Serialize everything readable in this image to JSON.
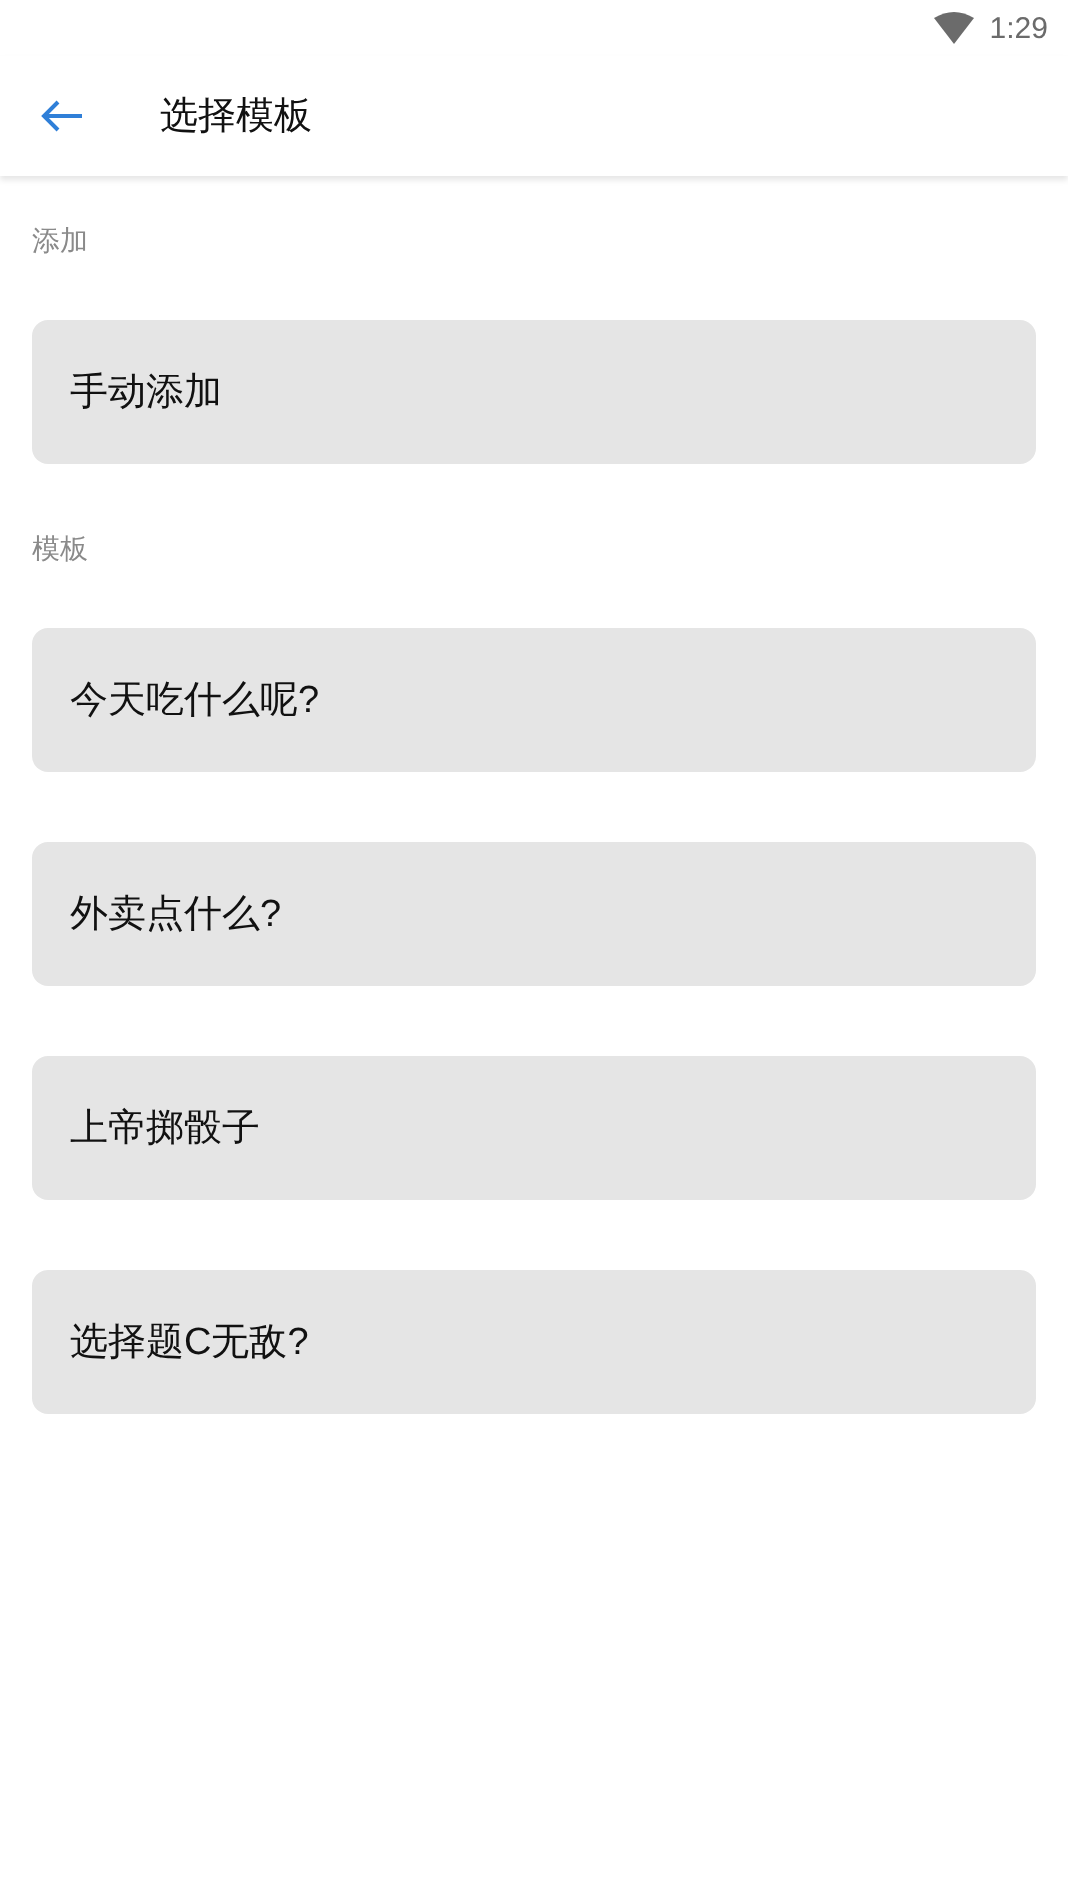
{
  "status_bar": {
    "time": "1:29"
  },
  "app_bar": {
    "title": "选择模板"
  },
  "sections": [
    {
      "label": "添加",
      "items": [
        {
          "label": "手动添加"
        }
      ]
    },
    {
      "label": "模板",
      "items": [
        {
          "label": "今天吃什么呢?"
        },
        {
          "label": "外卖点什么?"
        },
        {
          "label": "上帝掷骰子"
        },
        {
          "label": "选择题C无敌?"
        }
      ]
    }
  ]
}
